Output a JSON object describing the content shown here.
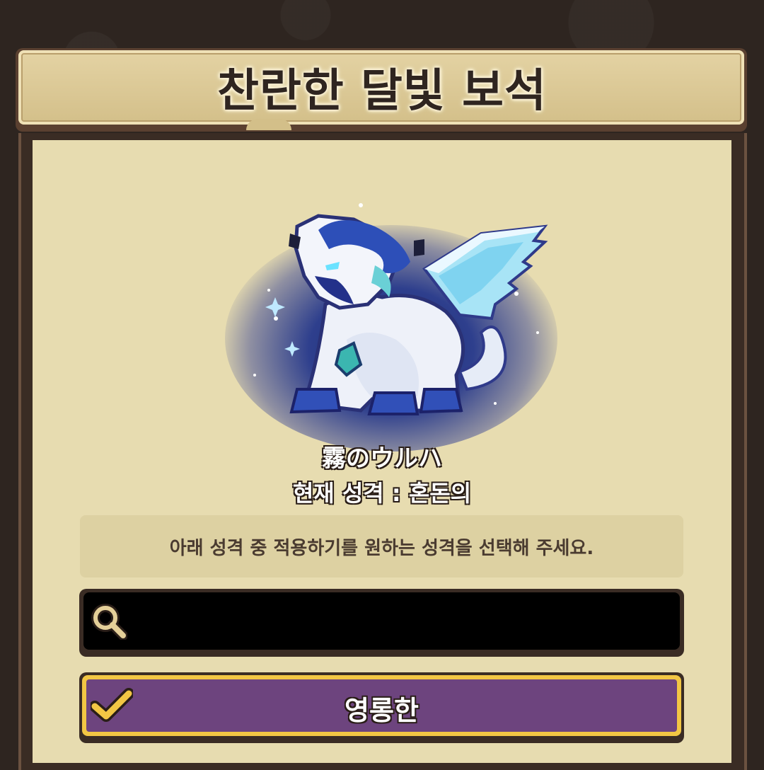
{
  "dialog": {
    "title": "찬란한 달빛 보석"
  },
  "character": {
    "name": "霧のウルハ",
    "current_trait": "현재 성격 : 혼돈의",
    "image_icon": "dragon-pet-sprite"
  },
  "instruction": {
    "text": "아래 성격 중 적용하기를 원하는 성격을 선택해 주세요."
  },
  "search": {
    "icon": "search-icon",
    "value": "",
    "placeholder": ""
  },
  "options": [
    {
      "label": "영롱한",
      "selected": true,
      "icon": "check-icon"
    }
  ],
  "colors": {
    "panel_bg": "#e7dcb0",
    "banner": "#d3bf89",
    "frame": "#3a2c24",
    "option_selected": "#6d447e",
    "option_border": "#f2c644"
  }
}
